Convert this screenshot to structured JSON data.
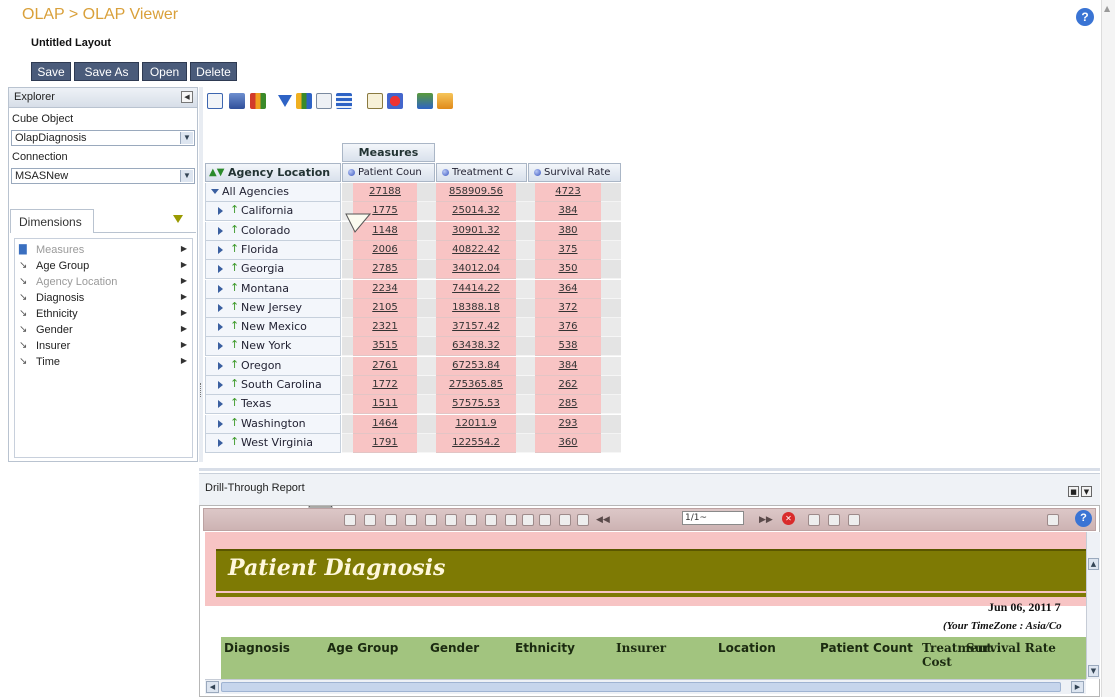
{
  "header": {
    "breadcrumb": "OLAP > OLAP Viewer",
    "layout_title": "Untitled Layout",
    "help_label": "?",
    "buttons": {
      "save": "Save",
      "save_as": "Save As",
      "open": "Open",
      "delete": "Delete"
    }
  },
  "explorer": {
    "title": "Explorer",
    "cube_label": "Cube Object",
    "cube_value": "OlapDiagnosis",
    "connection_label": "Connection",
    "connection_value": "MSASNew",
    "dimensions_tab": "Dimensions",
    "dimensions": [
      {
        "label": "Measures",
        "icon": "measures-icon",
        "dimmed": true
      },
      {
        "label": "Age Group",
        "icon": "hierarchy-icon",
        "dimmed": false
      },
      {
        "label": "Agency Location",
        "icon": "hierarchy-icon",
        "dimmed": true
      },
      {
        "label": "Diagnosis",
        "icon": "hierarchy-icon",
        "dimmed": false
      },
      {
        "label": "Ethnicity",
        "icon": "hierarchy-icon",
        "dimmed": false
      },
      {
        "label": "Gender",
        "icon": "hierarchy-icon",
        "dimmed": false
      },
      {
        "label": "Insurer",
        "icon": "hierarchy-icon",
        "dimmed": false
      },
      {
        "label": "Time",
        "icon": "hierarchy-icon",
        "dimmed": false
      }
    ]
  },
  "pivot": {
    "measures_header": "Measures",
    "row_header": "Agency Location",
    "columns": [
      "Patient Coun",
      "Treatment C",
      "Survival Rate"
    ],
    "rows": [
      {
        "name": "All Agencies",
        "patient_count": "27188",
        "treatment_cost": "858909.56",
        "survival_rate": "4723"
      },
      {
        "name": "California",
        "patient_count": "1775",
        "treatment_cost": "25014.32",
        "survival_rate": "384"
      },
      {
        "name": "Colorado",
        "patient_count": "1148",
        "treatment_cost": "30901.32",
        "survival_rate": "380"
      },
      {
        "name": "Florida",
        "patient_count": "2006",
        "treatment_cost": "40822.42",
        "survival_rate": "375"
      },
      {
        "name": "Georgia",
        "patient_count": "2785",
        "treatment_cost": "34012.04",
        "survival_rate": "350"
      },
      {
        "name": "Montana",
        "patient_count": "2234",
        "treatment_cost": "74414.22",
        "survival_rate": "364"
      },
      {
        "name": "New Jersey",
        "patient_count": "2105",
        "treatment_cost": "18388.18",
        "survival_rate": "372"
      },
      {
        "name": "New Mexico",
        "patient_count": "2321",
        "treatment_cost": "37157.42",
        "survival_rate": "376"
      },
      {
        "name": "New York",
        "patient_count": "3515",
        "treatment_cost": "63438.32",
        "survival_rate": "538"
      },
      {
        "name": "Oregon",
        "patient_count": "2761",
        "treatment_cost": "67253.84",
        "survival_rate": "384"
      },
      {
        "name": "South Carolina",
        "patient_count": "1772",
        "treatment_cost": "275365.85",
        "survival_rate": "262"
      },
      {
        "name": "Texas",
        "patient_count": "1511",
        "treatment_cost": "57575.53",
        "survival_rate": "285"
      },
      {
        "name": "Washington",
        "patient_count": "1464",
        "treatment_cost": "12011.9",
        "survival_rate": "293"
      },
      {
        "name": "West Virginia",
        "patient_count": "1791",
        "treatment_cost": "122554.2",
        "survival_rate": "360"
      }
    ]
  },
  "drill": {
    "title": "Drill-Through Report",
    "page_value": "1/1~",
    "report_title": "Patient Diagnosis",
    "date": "Jun 06, 2011   7",
    "timezone": "(Your TimeZone : Asia/Co",
    "columns": [
      "Diagnosis",
      "Age Group",
      "Gender",
      "Ethnicity",
      "Insurer",
      "Location",
      "Patient Count",
      "Treatment Cost",
      "Survival Rate"
    ]
  },
  "colors": {
    "breadcrumb": "#d9a03a",
    "button_bg": "#4a5b7a",
    "cell_pink": "#f8c4c4",
    "report_title_band": "#7e7a04",
    "report_column_band": "#a2c47f",
    "accent_blue": "#3a74d4"
  }
}
